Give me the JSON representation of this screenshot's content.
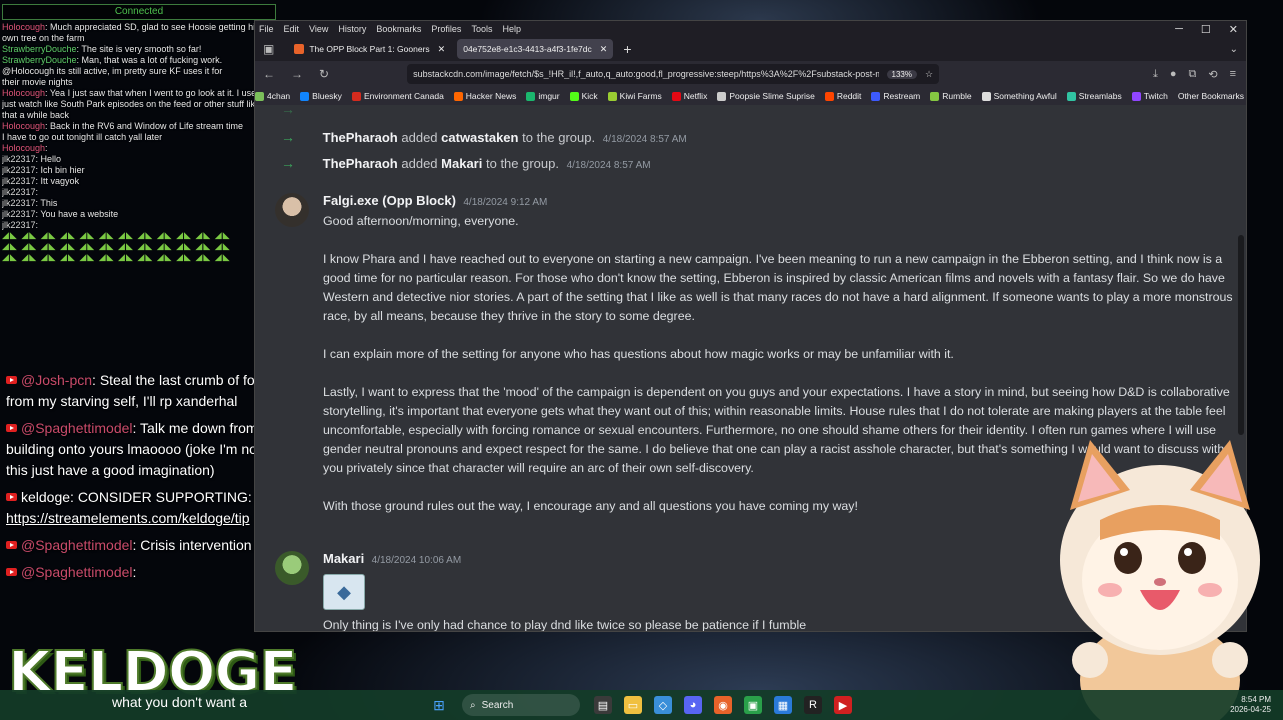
{
  "overlay": {
    "connected": "Connected",
    "mini_chat": [
      {
        "user": "Holocough",
        "cls": "u-holo",
        "text": "Much appreciated SD, glad to see Hoosie getting his"
      },
      {
        "user": "",
        "cls": "",
        "text": "own tree on the farm"
      },
      {
        "user": "StrawberryDouche",
        "cls": "u-straw",
        "text": "The site is very smooth so far!"
      },
      {
        "user": "StrawberryDouche",
        "cls": "u-straw",
        "text": "Man, that was a lot of fucking work."
      },
      {
        "user": "",
        "cls": "",
        "text": "@Holocough its still active, im pretty sure KF uses it for"
      },
      {
        "user": "",
        "cls": "",
        "text": "their movie nights"
      },
      {
        "user": "Holocough",
        "cls": "u-holo",
        "text": "Yea I just saw that when I went to go look at it. I used to"
      },
      {
        "user": "",
        "cls": "",
        "text": "just watch like South Park episodes on the feed or other stuff like"
      },
      {
        "user": "",
        "cls": "",
        "text": "that a while back"
      },
      {
        "user": "Holocough",
        "cls": "u-holo",
        "text": "Back in the RV6 and Window of Life stream time"
      },
      {
        "user": "",
        "cls": "",
        "text": "I have to go out tonight ill catch yall later"
      },
      {
        "user": "Holocough",
        "cls": "u-holo",
        "text": ""
      },
      {
        "user": "jlk22317",
        "cls": "u-jlk",
        "text": "Hello"
      },
      {
        "user": "jlk22317",
        "cls": "u-jlk",
        "text": "Ich bin hier"
      },
      {
        "user": "jlk22317",
        "cls": "u-jlk",
        "text": "Itt vagyok"
      },
      {
        "user": "jlk22317",
        "cls": "u-jlk",
        "text": ""
      },
      {
        "user": "jlk22317",
        "cls": "u-jlk",
        "text": "This"
      },
      {
        "user": "jlk22317",
        "cls": "u-jlk",
        "text": "You have a website"
      },
      {
        "user": "jlk22317",
        "cls": "u-jlk",
        "text": ""
      }
    ],
    "big_chat": [
      {
        "user": "@Josh-pcn",
        "text": "Steal the last crumb of food from my starving self, I'll rp xanderhal",
        "link": ""
      },
      {
        "user": "@Spaghettimodel",
        "text": "Talk me down from a building onto yours lmaoooo (joke I'm not into this just have a good imagination)",
        "link": ""
      },
      {
        "user": "",
        "text": "keldoge: CONSIDER SUPPORTING:",
        "link": "https://streamelements.com/keldoge/tip"
      },
      {
        "user": "@Spaghettimodel",
        "text": "Crisis intervention play?",
        "link": ""
      },
      {
        "user": "@Spaghettimodel",
        "text": "",
        "link": ""
      }
    ],
    "big_chat_tail": "what you don't want a",
    "brand": "KELDOGE"
  },
  "browser": {
    "menus": [
      "File",
      "Edit",
      "View",
      "History",
      "Bookmarks",
      "Profiles",
      "Tools",
      "Help"
    ],
    "tabs": [
      {
        "title": "The OPP Block Part 1: Gooners",
        "active": false
      },
      {
        "title": "04e752e8-e1c3-4413-a4f3-1fe7dc",
        "active": true
      }
    ],
    "url": "substackcdn.com/image/fetch/$s_!HR_il!,f_auto,q_auto:good,fl_progressive:steep/https%3A%2F%2Fsubstack-post-media.s",
    "zoom": "133%",
    "bookmarks": [
      {
        "label": "4chan",
        "color": "#7bbf5a"
      },
      {
        "label": "Bluesky",
        "color": "#1185fe"
      },
      {
        "label": "Environment Canada",
        "color": "#d52b1e"
      },
      {
        "label": "Hacker News",
        "color": "#ff6600"
      },
      {
        "label": "imgur",
        "color": "#1bb76e"
      },
      {
        "label": "Kick",
        "color": "#53fc18"
      },
      {
        "label": "Kiwi Farms",
        "color": "#9acd32"
      },
      {
        "label": "Netflix",
        "color": "#e50914"
      },
      {
        "label": "Poopsie Slime Suprise",
        "color": "#cccccc"
      },
      {
        "label": "Reddit",
        "color": "#ff4500"
      },
      {
        "label": "Restream",
        "color": "#3d5afe"
      },
      {
        "label": "Rumble",
        "color": "#85c742"
      },
      {
        "label": "Something Awful",
        "color": "#dddddd"
      },
      {
        "label": "Streamlabs",
        "color": "#31c3a2"
      },
      {
        "label": "Twitch",
        "color": "#9146ff"
      }
    ],
    "other_bookmarks": "Other Bookmarks"
  },
  "discord": {
    "system_rows": [
      {
        "actor": "ThePharaoh",
        "verb": "added",
        "target": "catwastaken",
        "suffix": "to the group.",
        "time": "4/18/2024 8:57 AM"
      },
      {
        "actor": "ThePharaoh",
        "verb": "added",
        "target": "Makari",
        "suffix": "to the group.",
        "time": "4/18/2024 8:57 AM"
      }
    ],
    "messages": [
      {
        "author": "Falgi.exe (Opp Block)",
        "time": "4/18/2024 9:12 AM",
        "paragraphs": [
          "Good afternoon/morning, everyone.",
          "I know Phara and I have reached out to everyone on starting a new campaign. I've been meaning to run a new campaign in the Ebberon setting, and I think now is a good time for no particular reason. For those who don't know the setting, Ebberon is inspired by classic American films and novels with a fantasy flair. So we do have Western and detective nior stories. A part of the setting that I like as well is that many races do not have a hard alignment. If someone wants to play a more monstrous race, by all means, because they thrive in the story to some degree.",
          "I can explain more of the setting for anyone who has questions about how magic works or may be unfamiliar with it.",
          "Lastly, I want to express that the 'mood' of the campaign is dependent on you guys and your expectations. I have a story in mind, but seeing how D&D is collaborative storytelling, it's important that everyone gets what they want out of this; within reasonable limits. House rules that I do not tolerate are making players at the table feel uncomfortable, especially with forcing romance or sexual encounters. Furthermore, no one should shame others for their identity. I often run games where I will use gender neutral pronouns and expect respect for the same. I do believe that one can play a racist asshole character, but that's something I would want to discuss with you privately since that character will require an arc of their own self-discovery.",
          "With those ground rules out the way, I encourage any and all questions you have coming my way!"
        ]
      },
      {
        "author": "Makari",
        "time": "4/18/2024 10:06 AM",
        "paragraphs": [
          "Only thing is I've only had chance to play dnd like twice so please be patience if I fumble"
        ]
      }
    ]
  },
  "taskbar": {
    "search": "Search",
    "time": "8:54 PM",
    "date": "2026-04-25"
  }
}
